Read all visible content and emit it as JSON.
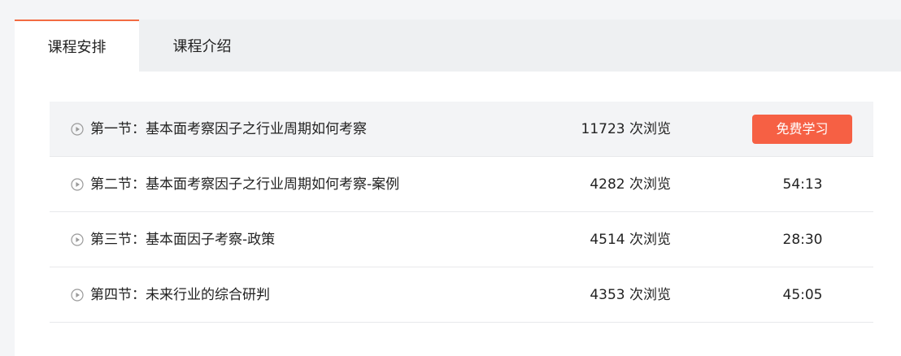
{
  "tabs": [
    {
      "label": "课程安排",
      "active": true
    },
    {
      "label": "课程介绍",
      "active": false
    }
  ],
  "lessons": [
    {
      "title": "第一节：基本面考察因子之行业周期如何考察",
      "views": "11723 次浏览",
      "action": "免费学习",
      "duration": ""
    },
    {
      "title": "第二节：基本面考察因子之行业周期如何考察-案例",
      "views": "4282 次浏览",
      "duration": "54:13"
    },
    {
      "title": "第三节：基本面因子考察-政策",
      "views": "4514 次浏览",
      "duration": "28:30"
    },
    {
      "title": "第四节：未来行业的综合研判",
      "views": "4353 次浏览",
      "duration": "45:05"
    }
  ],
  "icons": {
    "row_icon": "play-circle-icon"
  },
  "colors": {
    "accent": "#f26b43",
    "button_bg": "#f66044",
    "highlight_row": "#f3f4f6"
  }
}
